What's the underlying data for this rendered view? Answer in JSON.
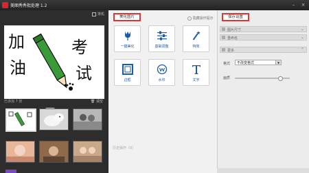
{
  "window": {
    "title": "美图秀秀批处理 1.2",
    "minimize_icon": "minimize-icon",
    "close_icon": "close-icon"
  },
  "left_panel": {
    "sort_label": "排机",
    "preview": {
      "chars": [
        "加",
        "油",
        "考",
        "试"
      ]
    },
    "added_label": "已添加 7 张",
    "clear_label": "清空",
    "thumbnails": [
      "thumb-1",
      "thumb-2",
      "thumb-3",
      "thumb-4",
      "thumb-5",
      "thumb-6"
    ]
  },
  "middle_panel": {
    "active_tab": "美化图片",
    "hide_tips_link": "隐藏操作提示",
    "tools": [
      {
        "label": "一键美化",
        "icon": "tulip-icon"
      },
      {
        "label": "基础调整",
        "icon": "sliders-icon"
      },
      {
        "label": "特效",
        "icon": "magic-wand-icon"
      },
      {
        "label": "边框",
        "icon": "frame-icon"
      },
      {
        "label": "水印",
        "icon": "watermark-icon"
      },
      {
        "label": "文字",
        "icon": "text-icon"
      }
    ],
    "history_label": "历史操作（0）"
  },
  "right_panel": {
    "save_tab": "保存设置",
    "sections": [
      {
        "label": "图片尺寸"
      },
      {
        "label": "重命名"
      },
      {
        "label": "更多"
      }
    ],
    "format_label": "格式",
    "format_value": "不改变格式",
    "quality_label": "画质",
    "accent_color": "#e03333"
  }
}
